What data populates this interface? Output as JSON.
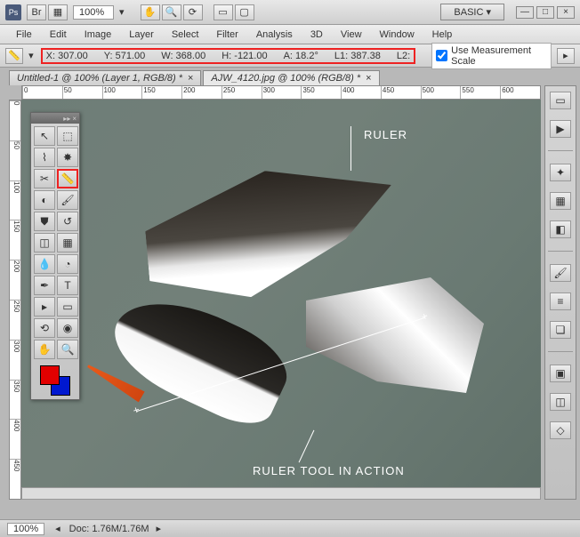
{
  "titlebar": {
    "app": "Ps",
    "br": "Br",
    "zoom": "100%",
    "workspace": "BASIC"
  },
  "menu": [
    "File",
    "Edit",
    "Image",
    "Layer",
    "Select",
    "Filter",
    "Analysis",
    "3D",
    "View",
    "Window",
    "Help"
  ],
  "options": {
    "x": "X: 307.00",
    "y": "Y: 571.00",
    "w": "W: 368.00",
    "h": "H: -121.00",
    "a": "A: 18.2°",
    "l1": "L1: 387.38",
    "l2": "L2:",
    "measure_label": "Use Measurement Scale"
  },
  "tabs": [
    {
      "label": "Untitled-1 @ 100% (Layer 1, RGB/8) *"
    },
    {
      "label": "AJW_4120.jpg @ 100% (RGB/8) *"
    }
  ],
  "hruler": [
    "0",
    "50",
    "100",
    "150",
    "200",
    "250",
    "300",
    "350",
    "400",
    "450",
    "500",
    "550",
    "600"
  ],
  "vruler": [
    "0",
    "50",
    "100",
    "150",
    "200",
    "250",
    "300",
    "350",
    "400",
    "450"
  ],
  "annotations": {
    "ruler": "RULER",
    "action": "RULER TOOL IN ACTION"
  },
  "status": {
    "zoom": "100%",
    "doc": "Doc: 1.76M/1.76M"
  }
}
